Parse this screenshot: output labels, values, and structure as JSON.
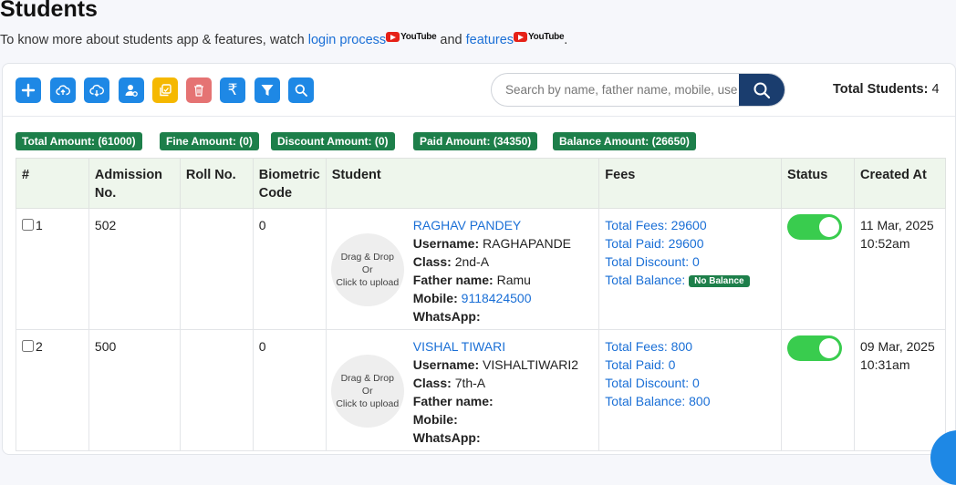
{
  "page": {
    "title": "Students",
    "intro_text": "To know more about students app & features, watch",
    "link_login": "login process",
    "and_text": "and",
    "link_features": "features",
    "end_text": ".",
    "youtube_label": "YouTube"
  },
  "toolbar": {
    "buttons": [
      {
        "name": "add-student-button",
        "icon": "plus-icon",
        "color": "#1e88e5"
      },
      {
        "name": "upload-button",
        "icon": "cloud-upload-icon",
        "color": "#1e88e5"
      },
      {
        "name": "download-button",
        "icon": "cloud-download-icon",
        "color": "#1e88e5"
      },
      {
        "name": "user-button",
        "icon": "user-settings-icon",
        "color": "#1e88e5"
      },
      {
        "name": "copy-button",
        "icon": "copy-icon",
        "color": "#f5b800"
      },
      {
        "name": "delete-button",
        "icon": "trash-icon",
        "color": "#e57373"
      },
      {
        "name": "fees-button",
        "icon": "rupee-icon",
        "color": "#1e88e5"
      },
      {
        "name": "filter-button",
        "icon": "filter-icon",
        "color": "#1e88e5"
      },
      {
        "name": "find-button",
        "icon": "search-icon",
        "color": "#1e88e5"
      }
    ],
    "rupee_glyph": "₹",
    "search_placeholder": "Search by name, father name, mobile, username",
    "total_label": "Total Students:",
    "total_value": "4"
  },
  "summary": [
    "Total Amount: (61000)",
    "Fine Amount: (0)",
    "Discount Amount: (0)",
    "Paid Amount: (34350)",
    "Balance Amount: (26650)"
  ],
  "table": {
    "headers": {
      "num": "#",
      "admission": "Admission No.",
      "roll": "Roll No.",
      "biometric": "Biometric Code",
      "student": "Student",
      "fees": "Fees",
      "status": "Status",
      "created": "Created At"
    },
    "upload": {
      "line1": "Drag & Drop",
      "line2": "Or",
      "line3": "Click to upload"
    },
    "labels": {
      "username": "Username:",
      "class": "Class:",
      "father": "Father name:",
      "mobile": "Mobile:",
      "whatsapp": "WhatsApp:",
      "total_fees": "Total Fees:",
      "total_paid": "Total Paid:",
      "total_discount": "Total Discount:",
      "total_balance": "Total Balance:"
    },
    "rows": [
      {
        "index": "1",
        "admission": "502",
        "roll": "",
        "biometric": "0",
        "name": "RAGHAV PANDEY",
        "username": "RAGHAPANDE",
        "class": "2nd-A",
        "father": "Ramu",
        "mobile": "9118424500",
        "whatsapp": "",
        "total_fees": "29600",
        "total_paid": "29600",
        "total_discount": "0",
        "total_balance": "",
        "balance_badge": "No Balance",
        "status_on": true,
        "created_date": "11 Mar, 2025",
        "created_time": "10:52am"
      },
      {
        "index": "2",
        "admission": "500",
        "roll": "",
        "biometric": "0",
        "name": "VISHAL TIWARI",
        "username": "VISHALTIWARI2",
        "class": "7th-A",
        "father": "",
        "mobile": "",
        "whatsapp": "",
        "total_fees": "800",
        "total_paid": "0",
        "total_discount": "0",
        "total_balance": "800",
        "balance_badge": "",
        "status_on": true,
        "created_date": "09 Mar, 2025",
        "created_time": "10:31am"
      }
    ]
  },
  "colors": {
    "primary": "#1e88e5",
    "link": "#1a6fd6",
    "badge_green": "#1d7f4a",
    "toggle_on": "#39cc4e",
    "search_button": "#1a3d6e",
    "header_bg": "#eef6ec"
  }
}
